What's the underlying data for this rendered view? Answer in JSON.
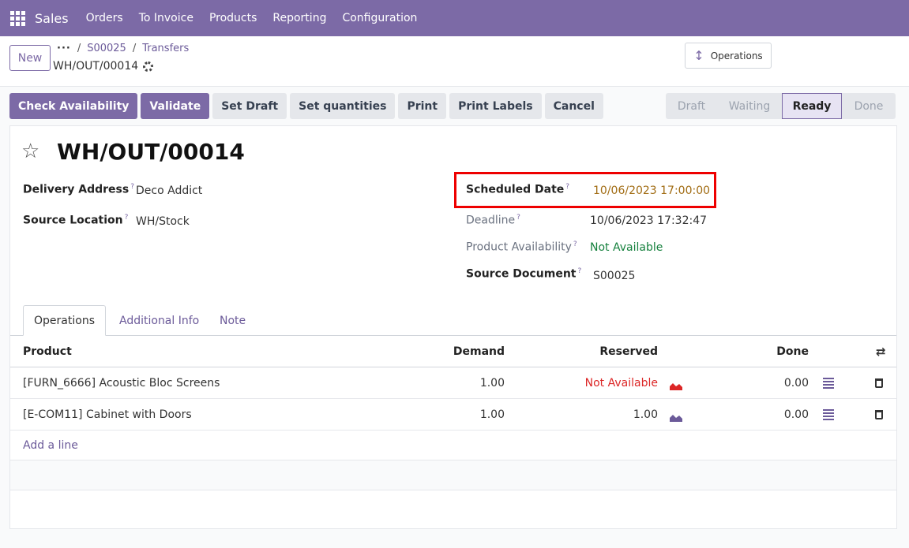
{
  "topbar": {
    "app_name": "Sales",
    "menu": [
      "Orders",
      "To Invoice",
      "Products",
      "Reporting",
      "Configuration"
    ]
  },
  "control": {
    "new_label": "New",
    "breadcrumb": [
      "S00025",
      "Transfers"
    ],
    "record_name": "WH/OUT/00014",
    "operations_label": "Operations"
  },
  "actions": [
    "Check Availability",
    "Validate",
    "Set Draft",
    "Set quantities",
    "Print",
    "Print Labels",
    "Cancel"
  ],
  "status": {
    "stages": [
      "Draft",
      "Waiting",
      "Ready",
      "Done"
    ],
    "current": "Ready"
  },
  "form": {
    "title": "WH/OUT/00014",
    "delivery_address_label": "Delivery Address",
    "delivery_address": "Deco Addict",
    "source_location_label": "Source Location",
    "source_location": "WH/Stock",
    "scheduled_date_label": "Scheduled Date",
    "scheduled_date": "10/06/2023 17:00:00",
    "deadline_label": "Deadline",
    "deadline": "10/06/2023 17:32:47",
    "availability_label": "Product Availability",
    "availability": "Not Available",
    "source_document_label": "Source Document",
    "source_document": "S00025",
    "help_marker": "?"
  },
  "tabs": [
    "Operations",
    "Additional Info",
    "Note"
  ],
  "table": {
    "headers": {
      "product": "Product",
      "demand": "Demand",
      "reserved": "Reserved",
      "done": "Done"
    },
    "rows": [
      {
        "product": "[FURN_6666] Acoustic Bloc Screens",
        "demand": "1.00",
        "reserved": "Not Available",
        "done": "0.00"
      },
      {
        "product": "[E-COM11] Cabinet with Doors",
        "demand": "1.00",
        "reserved": "1.00",
        "done": "0.00"
      }
    ],
    "add_line": "Add a line"
  },
  "colors": {
    "brand": "#7c6aa6",
    "highlight": "#e00000",
    "danger": "#dc2626",
    "success": "#15803d"
  }
}
